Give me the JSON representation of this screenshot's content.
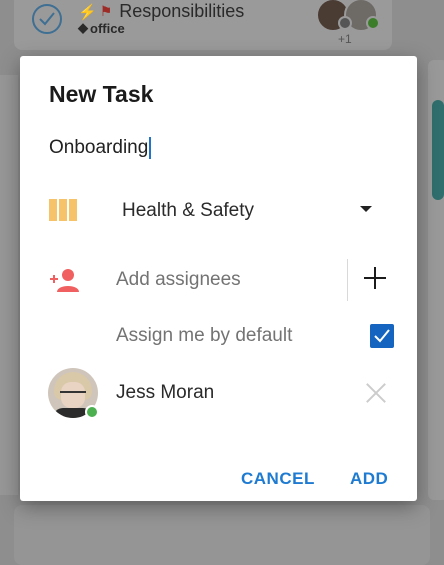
{
  "background": {
    "task_title": "Responsibilities",
    "task_tag": "office",
    "extra_assignees": "+1"
  },
  "dialog": {
    "title": "New Task",
    "task_name": "Onboarding",
    "project": "Health & Safety",
    "assignee_placeholder": "Add assignees",
    "assign_default_label": "Assign me by default",
    "assign_default_checked": true,
    "assignees": [
      {
        "name": "Jess Moran",
        "online": true
      }
    ],
    "buttons": {
      "cancel": "CANCEL",
      "add": "ADD"
    }
  },
  "colors": {
    "accent": "#1e7bd1",
    "checkbox": "#1565c0",
    "project_icon": "#f6c36a",
    "person_add_icon": "#f06060",
    "online": "#4caf50"
  }
}
